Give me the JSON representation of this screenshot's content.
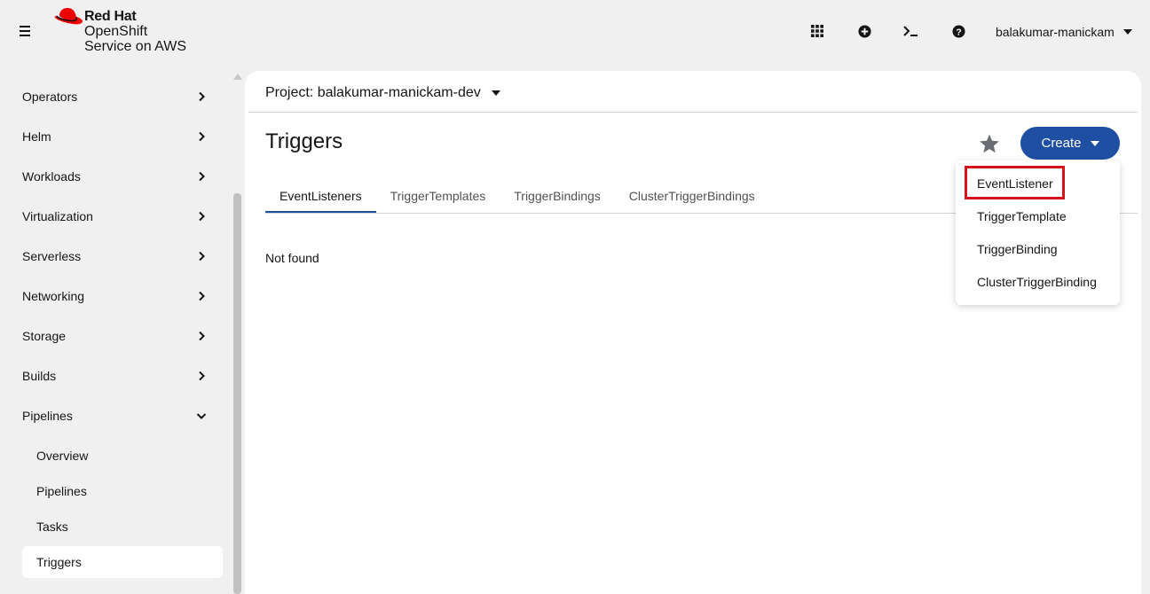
{
  "brand": {
    "line1": "Red Hat",
    "line2": "OpenShift",
    "line3": "Service on AWS",
    "hat_color": "#ee0000"
  },
  "masthead": {
    "icons": [
      "apps-grid-icon",
      "add-circle-icon",
      "terminal-icon",
      "help-icon"
    ],
    "username": "balakumar-manickam"
  },
  "sidebar": {
    "items": [
      {
        "label": "Operators",
        "expanded": false
      },
      {
        "label": "Helm",
        "expanded": false
      },
      {
        "label": "Workloads",
        "expanded": false
      },
      {
        "label": "Virtualization",
        "expanded": false
      },
      {
        "label": "Serverless",
        "expanded": false
      },
      {
        "label": "Networking",
        "expanded": false
      },
      {
        "label": "Storage",
        "expanded": false
      },
      {
        "label": "Builds",
        "expanded": false
      },
      {
        "label": "Pipelines",
        "expanded": true
      }
    ],
    "sub_items": [
      {
        "label": "Overview",
        "active": false
      },
      {
        "label": "Pipelines",
        "active": false
      },
      {
        "label": "Tasks",
        "active": false
      },
      {
        "label": "Triggers",
        "active": true
      }
    ]
  },
  "main": {
    "project_label": "Project: balakumar-manickam-dev",
    "title": "Triggers",
    "create_label": "Create",
    "tabs": [
      {
        "label": "EventListeners",
        "active": true
      },
      {
        "label": "TriggerTemplates",
        "active": false
      },
      {
        "label": "TriggerBindings",
        "active": false
      },
      {
        "label": "ClusterTriggerBindings",
        "active": false
      }
    ],
    "empty_message": "Not found"
  },
  "create_menu": {
    "items": [
      "EventListener",
      "TriggerTemplate",
      "TriggerBinding",
      "ClusterTriggerBinding"
    ],
    "highlighted": "EventListener"
  },
  "colors": {
    "primary": "#1f4fa3",
    "highlight": "#d6131b",
    "background": "#f0f0f0"
  }
}
